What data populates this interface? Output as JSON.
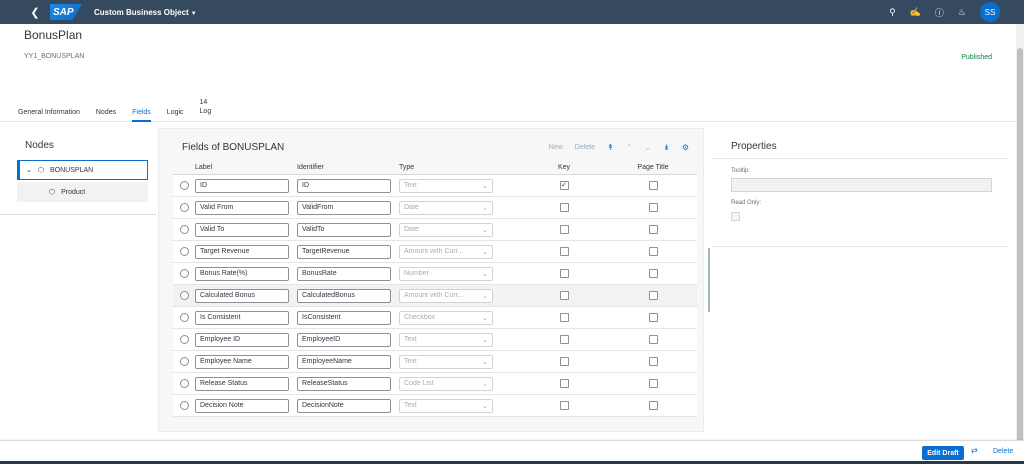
{
  "shell": {
    "back_icon": "back-icon",
    "logo": "SAP",
    "title": "Custom Business Object",
    "avatar": "SS"
  },
  "header": {
    "title": "BonusPlan",
    "subtitle": "YY1_BONUSPLAN",
    "status": "Published"
  },
  "tabs": [
    {
      "label": "General Information"
    },
    {
      "label": "Nodes"
    },
    {
      "label": "Fields"
    },
    {
      "label": "Logic"
    },
    {
      "count": "14",
      "label": "Log"
    }
  ],
  "nodes": {
    "title": "Nodes",
    "root": "BONUSPLAN",
    "child": "Product"
  },
  "fields": {
    "title": "Fields of BONUSPLAN",
    "toolbar": {
      "new": "New",
      "delete": "Delete"
    },
    "columns": {
      "label": "Label",
      "identifier": "Identifier",
      "type": "Type",
      "key": "Key",
      "page_title": "Page Title"
    },
    "rows": [
      {
        "label": "ID",
        "identifier": "ID",
        "type": "Text",
        "key": true
      },
      {
        "label": "Valid From",
        "identifier": "ValidFrom",
        "type": "Date",
        "key": false
      },
      {
        "label": "Valid To",
        "identifier": "ValidTo",
        "type": "Date",
        "key": false
      },
      {
        "label": "Target Revenue",
        "identifier": "TargetRevenue",
        "type": "Amount with Curr...",
        "key": false
      },
      {
        "label": "Bonus Rate(%)",
        "identifier": "BonusRate",
        "type": "Number",
        "key": false
      },
      {
        "label": "Calculated Bonus",
        "identifier": "CalculatedBonus",
        "type": "Amount with Curr...",
        "key": false
      },
      {
        "label": "Is Consistent",
        "identifier": "IsConsistent",
        "type": "Checkbox",
        "key": false
      },
      {
        "label": "Employee ID",
        "identifier": "EmployeeID",
        "type": "Text",
        "key": false
      },
      {
        "label": "Employee Name",
        "identifier": "EmployeeName",
        "type": "Text",
        "key": false
      },
      {
        "label": "Release Status",
        "identifier": "ReleaseStatus",
        "type": "Code List",
        "key": false
      },
      {
        "label": "Decision Note",
        "identifier": "DecisionNote",
        "type": "Text",
        "key": false
      }
    ]
  },
  "properties": {
    "title": "Properties",
    "tooltip_label": "Tooltip:",
    "read_only_label": "Read Only:"
  },
  "footer": {
    "edit_draft": "Edit Draft",
    "delete": "Delete"
  },
  "colors": {
    "shell": "#354a5f",
    "accent": "#0a6ed1",
    "published": "#107e3e"
  }
}
